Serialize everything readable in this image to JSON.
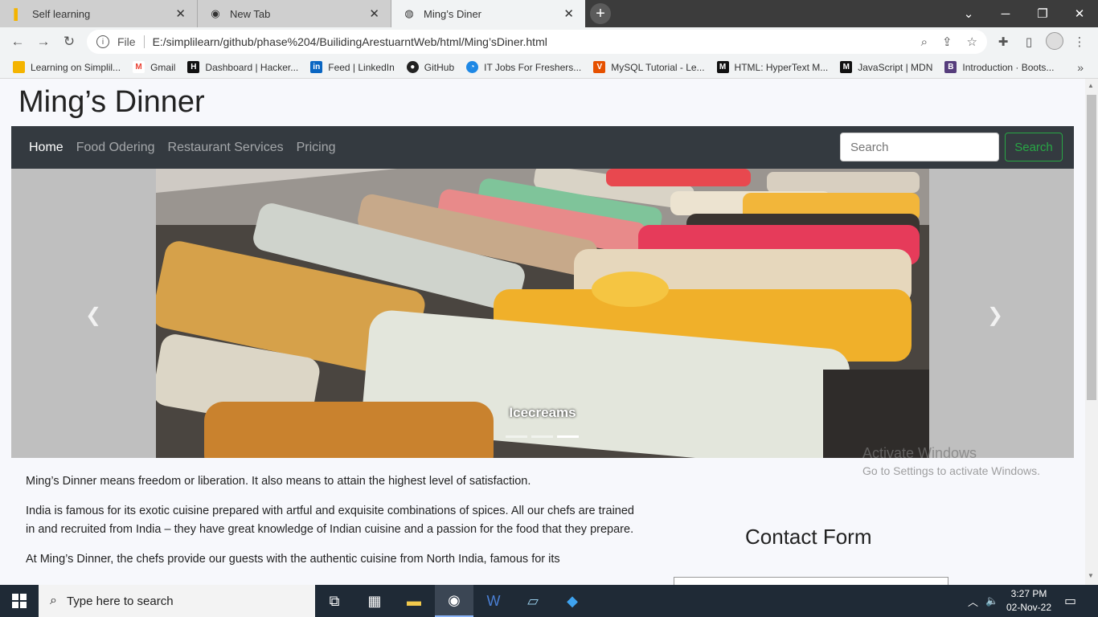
{
  "browser": {
    "tabs": [
      {
        "title": "Self learning",
        "active": false
      },
      {
        "title": "New Tab",
        "active": false
      },
      {
        "title": "Ming’s Diner",
        "active": true
      }
    ],
    "address": {
      "scheme_label": "File",
      "url": "E:/simplilearn/github/phase%204/BuilidingArestuarntWeb/html/Ming’sDiner.html"
    },
    "bookmarks": [
      {
        "label": "Learning on Simplil...",
        "icon": "simplilearn-icon",
        "color": "#f4b400"
      },
      {
        "label": "Gmail",
        "icon": "gmail-icon",
        "color": "#ea4335"
      },
      {
        "label": "Dashboard | Hacker...",
        "icon": "hackerrank-icon",
        "color": "#111111"
      },
      {
        "label": "Feed | LinkedIn",
        "icon": "linkedin-icon",
        "color": "#0a66c2"
      },
      {
        "label": "GitHub",
        "icon": "github-icon",
        "color": "#222222"
      },
      {
        "label": "IT Jobs For Freshers...",
        "icon": "jobs-icon",
        "color": "#1e88e5"
      },
      {
        "label": "MySQL Tutorial - Le...",
        "icon": "mysql-icon",
        "color": "#e65100"
      },
      {
        "label": "HTML: HyperText M...",
        "icon": "mdn-icon",
        "color": "#111111"
      },
      {
        "label": "JavaScript | MDN",
        "icon": "mdn-icon",
        "color": "#111111"
      },
      {
        "label": "Introduction · Boots...",
        "icon": "bootstrap-icon",
        "color": "#563d7c"
      }
    ]
  },
  "site": {
    "title": "Ming’s Dinner",
    "nav": [
      {
        "label": "Home",
        "active": true
      },
      {
        "label": "Food Odering",
        "active": false
      },
      {
        "label": "Restaurant Services",
        "active": false
      },
      {
        "label": "Pricing",
        "active": false
      }
    ],
    "search": {
      "placeholder": "Search",
      "button": "Search"
    },
    "carousel": {
      "caption": "Icecreams",
      "slide_count": 3,
      "active_index": 2
    },
    "paragraphs": [
      "Ming’s Dinner means freedom or liberation. It also means to attain the highest level of satisfaction.",
      "India is famous for its exotic cuisine prepared with artful and exquisite combinations of spices. All our chefs are trained in and recruited from India – they have great knowledge of Indian cuisine and a passion for the food that they prepare.",
      "At Ming’s Dinner, the chefs provide our guests with the authentic cuisine from North India, famous for its"
    ],
    "contact_title": "Contact Form"
  },
  "watermark": {
    "line1": "Activate Windows",
    "line2": "Go to Settings to activate Windows."
  },
  "taskbar": {
    "search_placeholder": "Type here to search",
    "time": "3:27 PM",
    "date": "02-Nov-22"
  }
}
